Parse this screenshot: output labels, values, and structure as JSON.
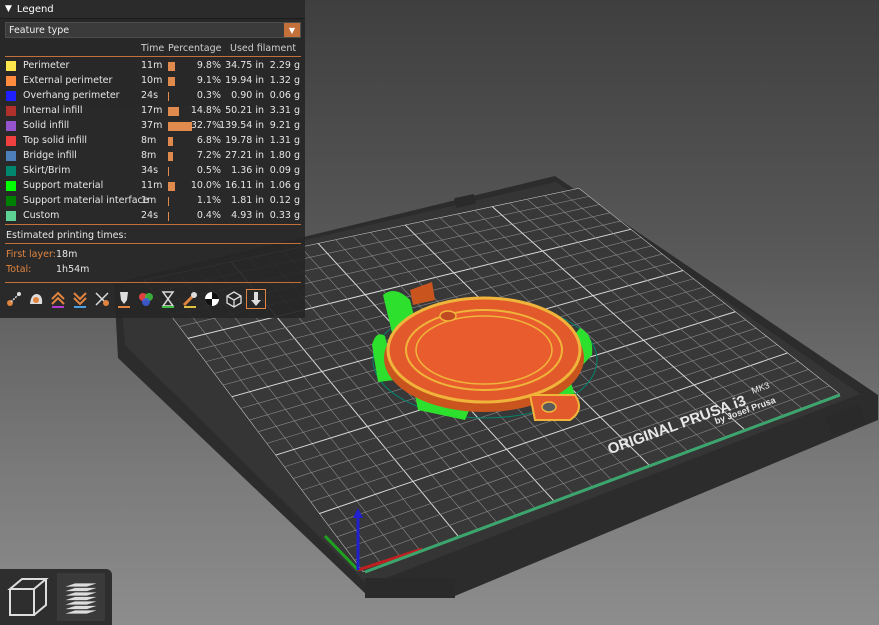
{
  "legend": {
    "title": "Legend",
    "view_type": "Feature type",
    "columns": {
      "time": "Time",
      "percentage": "Percentage",
      "filament": "Used filament"
    },
    "rows": [
      {
        "name": "Perimeter",
        "color": "#ffe64d",
        "time": "11m",
        "pct": "9.8%",
        "pct_value": 9.8,
        "length": "34.75 in",
        "weight": "2.29 g"
      },
      {
        "name": "External perimeter",
        "color": "#ff8c3f",
        "time": "10m",
        "pct": "9.1%",
        "pct_value": 9.1,
        "length": "19.94 in",
        "weight": "1.32 g"
      },
      {
        "name": "Overhang perimeter",
        "color": "#1f1fff",
        "time": "24s",
        "pct": "0.3%",
        "pct_value": 0.3,
        "length": "0.90 in",
        "weight": "0.06 g"
      },
      {
        "name": "Internal infill",
        "color": "#b1302a",
        "time": "17m",
        "pct": "14.8%",
        "pct_value": 14.8,
        "length": "50.21 in",
        "weight": "3.31 g"
      },
      {
        "name": "Solid infill",
        "color": "#9654cc",
        "time": "37m",
        "pct": "32.7%",
        "pct_value": 32.7,
        "length": "139.54 in",
        "weight": "9.21 g"
      },
      {
        "name": "Top solid infill",
        "color": "#f04040",
        "time": "8m",
        "pct": "6.8%",
        "pct_value": 6.8,
        "length": "19.78 in",
        "weight": "1.31 g"
      },
      {
        "name": "Bridge infill",
        "color": "#4d80ba",
        "time": "8m",
        "pct": "7.2%",
        "pct_value": 7.2,
        "length": "27.21 in",
        "weight": "1.80 g"
      },
      {
        "name": "Skirt/Brim",
        "color": "#00876e",
        "time": "34s",
        "pct": "0.5%",
        "pct_value": 0.5,
        "length": "1.36 in",
        "weight": "0.09 g"
      },
      {
        "name": "Support material",
        "color": "#00ff00",
        "time": "11m",
        "pct": "10.0%",
        "pct_value": 10.0,
        "length": "16.11 in",
        "weight": "1.06 g"
      },
      {
        "name": "Support material interface",
        "color": "#008000",
        "time": "1m",
        "pct": "1.1%",
        "pct_value": 1.1,
        "length": "1.81 in",
        "weight": "0.12 g"
      },
      {
        "name": "Custom",
        "color": "#5ed194",
        "time": "24s",
        "pct": "0.4%",
        "pct_value": 0.4,
        "length": "4.93 in",
        "weight": "0.33 g"
      }
    ],
    "estimated_label": "Estimated printing times:",
    "first_layer_label": "First layer:",
    "first_layer_value": "18m",
    "total_label": "Total:",
    "total_value": "1h54m",
    "toolbar_icons": [
      "travel-icon",
      "wipe-icon",
      "retractions-icon",
      "deretractions-icon",
      "seams-icon",
      "tool-changes-icon",
      "color-changes-icon",
      "pause-icon",
      "custom-gcode-icon",
      "center-of-gravity-icon",
      "shells-icon",
      "tool-marker-icon"
    ]
  },
  "bed": {
    "brand_line1": "ORIGINAL PRUSA i3",
    "brand_model": "MK3",
    "brand_line2": "by Josef Prusa"
  },
  "view_buttons": [
    "3d-view-icon",
    "layers-preview-icon"
  ],
  "colors": {
    "accent": "#e0843f",
    "panel": "#262626"
  }
}
